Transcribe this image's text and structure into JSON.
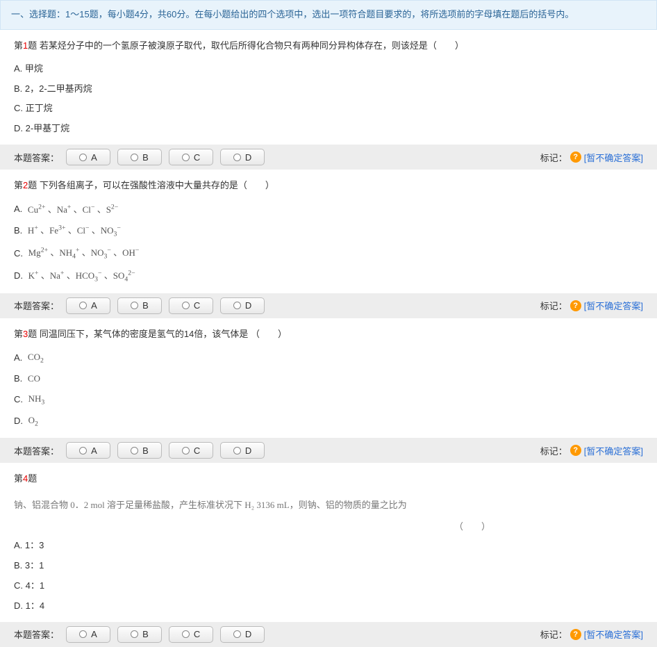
{
  "section_header": "一、选择题：1～15题，每小题4分，共60分。在每小题给出的四个选项中，选出一项符合题目要求的，将所选项前的字母填在题后的括号内。",
  "answer_bar": {
    "label": "本题答案：",
    "options": {
      "A": "A",
      "B": "B",
      "C": "C",
      "D": "D"
    },
    "mark_label": "标记：",
    "uncertain_link": "[暂不确定答案]"
  },
  "q1": {
    "num": "1",
    "prefix": "第",
    "suffix": "题",
    "stem": " 若某烃分子中的一个氢原子被溴原子取代，取代后所得化合物只有两种同分异构体存在，则该烃是（　　）",
    "A": "A. 甲烷",
    "B": "B. 2，2-二甲基丙烷",
    "C": "C. 正丁烷",
    "D": "D. 2-甲基丁烷"
  },
  "q2": {
    "num": "2",
    "prefix": "第",
    "suffix": "题",
    "stem": " 下列各组离子，可以在强酸性溶液中大量共存的是（　　）",
    "A_label": "A.",
    "B_label": "B.",
    "C_label": "C.",
    "D_label": "D.",
    "A_formula": "Cu²⁺ 、Na⁺ 、Cl⁻ 、S²⁻",
    "B_formula": "H⁺ 、Fe³⁺ 、Cl⁻ 、NO₃⁻",
    "C_formula": "Mg²⁺ 、NH₄⁺ 、NO₃⁻ 、OH⁻",
    "D_formula": "K⁺ 、Na⁺ 、HCO₃⁻ 、SO₄²⁻"
  },
  "q3": {
    "num": "3",
    "prefix": "第",
    "suffix": "题",
    "stem": " 同温同压下，某气体的密度是氢气的14倍，该气体是 （　　）",
    "A_label": "A.",
    "B_label": "B.",
    "C_label": "C.",
    "D_label": "D.",
    "A_formula": "CO₂",
    "B_formula": "CO",
    "C_formula": "NH₃",
    "D_formula": "O₂"
  },
  "q4": {
    "num": "4",
    "prefix": "第",
    "suffix": "题",
    "stem_line1": "钠、铝混合物 0．2 mol 溶于足量稀盐酸，产生标准状况下 H₂ 3136 mL，则钠、铝的物质的量之比为",
    "stem_line2": "（　　）",
    "A": "A. 1：3",
    "B": "B. 3：1",
    "C": "C. 4：1",
    "D": "D. 1：4"
  }
}
